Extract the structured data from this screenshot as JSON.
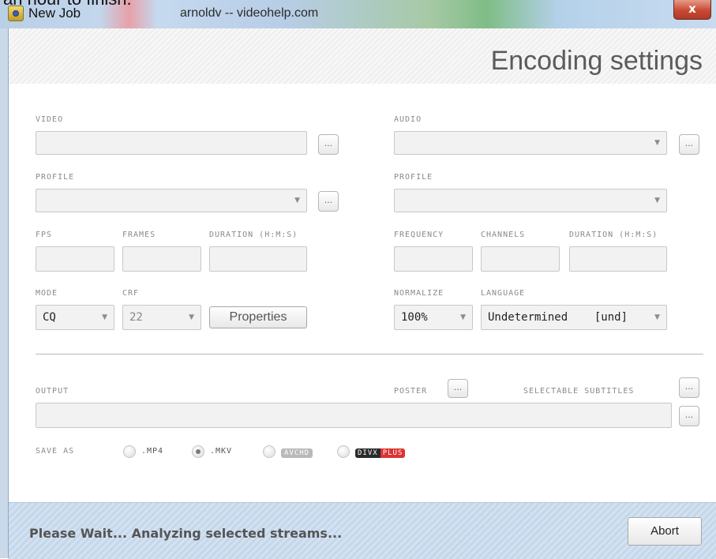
{
  "top_cut_text": "an hour to finish.",
  "window": {
    "title": "New Job",
    "subtitle": "arnoldv -- videohelp.com",
    "close_glyph": "x"
  },
  "header": {
    "title": "Encoding settings"
  },
  "video": {
    "label": "VIDEO",
    "profile_label": "PROFILE",
    "fps_label": "FPS",
    "frames_label": "FRAMES",
    "duration_label": "DURATION (H:M:S)",
    "mode_label": "MODE",
    "mode_value": "CQ",
    "crf_label": "CRF",
    "crf_value": "22",
    "properties_label": "Properties"
  },
  "audio": {
    "label": "AUDIO",
    "profile_label": "PROFILE",
    "frequency_label": "FREQUENCY",
    "channels_label": "CHANNELS",
    "duration_label": "DURATION (H:M:S)",
    "normalize_label": "NORMALIZE",
    "normalize_value": "100%",
    "language_label": "LANGUAGE",
    "language_value": "Undetermined    [und]"
  },
  "output": {
    "label": "OUTPUT",
    "poster_label": "POSTER",
    "subtitles_label": "SELECTABLE SUBTITLES",
    "save_as_label": "SAVE AS",
    "formats": [
      {
        "label": ".MP4",
        "selected": false
      },
      {
        "label": ".MKV",
        "selected": true
      },
      {
        "label": "AVCHD",
        "selected": false
      },
      {
        "label": "DIVX",
        "label2": "PLUS",
        "selected": false
      }
    ]
  },
  "dots_label": "...",
  "dropdown_arrow": "▼",
  "footer": {
    "status": "Please Wait... Analyzing selected streams...",
    "abort_label": "Abort"
  },
  "colors": {
    "accent_divx_plus": "#dd3333",
    "footer_bg": "#c5d7ea",
    "close_button": "#c94a34"
  }
}
